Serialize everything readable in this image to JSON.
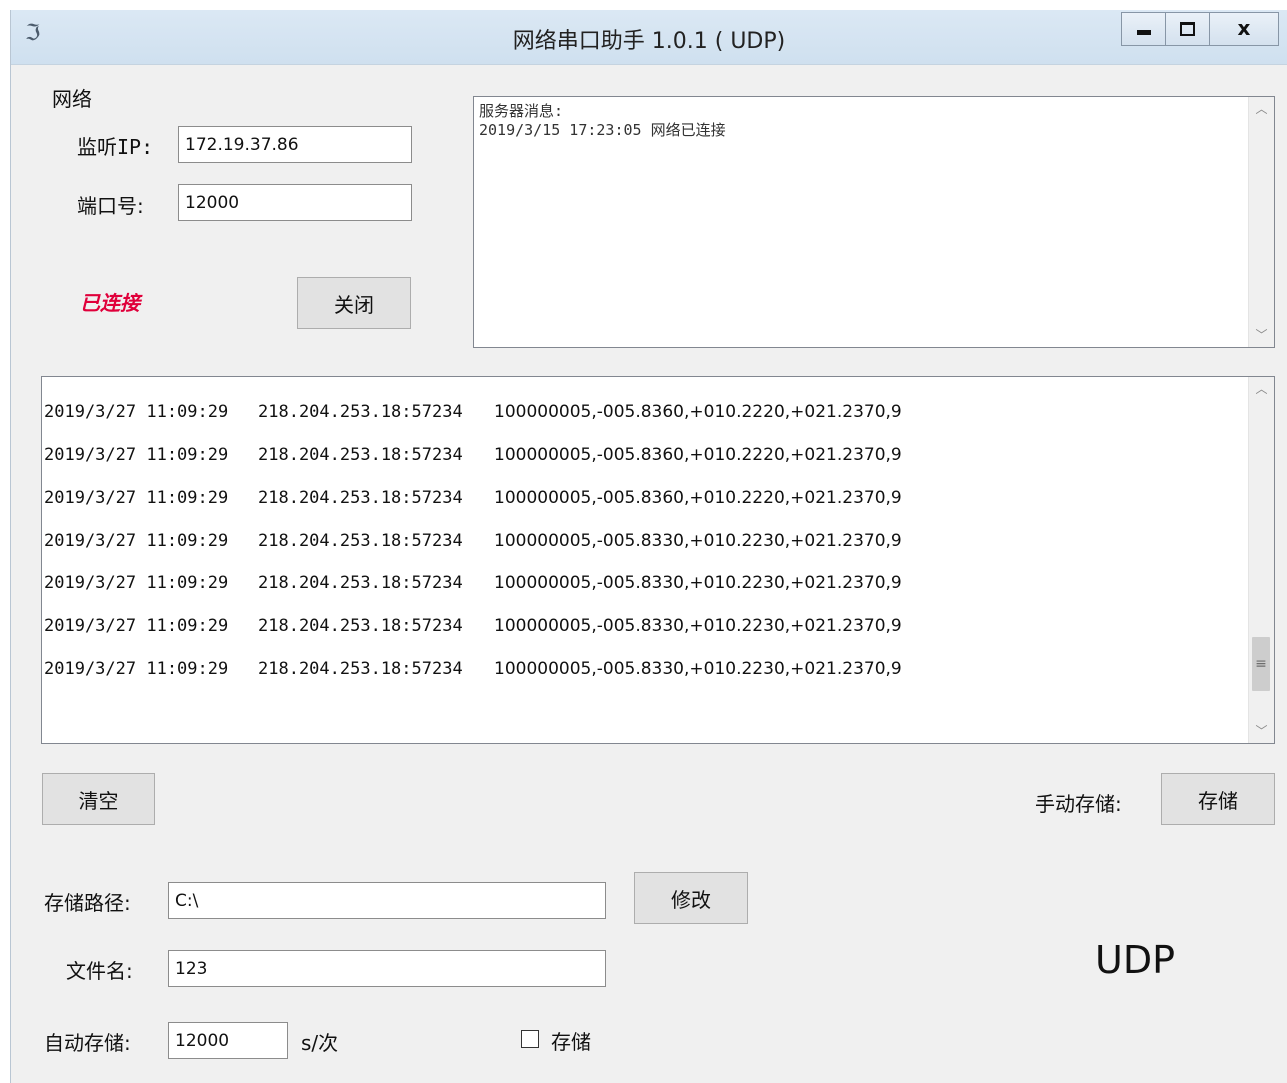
{
  "window": {
    "title": "网络串口助手 1.0.1 ( UDP)",
    "icon": "app-icon",
    "controls": {
      "minimize": "minimize",
      "maximize": "maximize",
      "close": "x"
    }
  },
  "network": {
    "group_label": "网络",
    "listen_ip_label": "监听IP:",
    "listen_ip_value": "172.19.37.86",
    "port_label": "端口号:",
    "port_value": "12000",
    "status_text": "已连接",
    "close_button": "关闭"
  },
  "server_messages": {
    "lines": [
      "服务器消息:",
      "2019/3/15 17:23:05 网络已连接"
    ]
  },
  "log": {
    "rows": [
      {
        "time": "2019/3/27 11:09:29",
        "addr": "218.204.253.18:57234",
        "data": "100000005,-005.8360,+010.2220,+021.2370,9"
      },
      {
        "time": "2019/3/27 11:09:29",
        "addr": "218.204.253.18:57234",
        "data": "100000005,-005.8360,+010.2220,+021.2370,9"
      },
      {
        "time": "2019/3/27 11:09:29",
        "addr": "218.204.253.18:57234",
        "data": "100000005,-005.8360,+010.2220,+021.2370,9"
      },
      {
        "time": "2019/3/27 11:09:29",
        "addr": "218.204.253.18:57234",
        "data": "100000005,-005.8330,+010.2230,+021.2370,9"
      },
      {
        "time": "2019/3/27 11:09:29",
        "addr": "218.204.253.18:57234",
        "data": "100000005,-005.8330,+010.2230,+021.2370,9"
      },
      {
        "time": "2019/3/27 11:09:29",
        "addr": "218.204.253.18:57234",
        "data": "100000005,-005.8330,+010.2230,+021.2370,9"
      },
      {
        "time": "2019/3/27 11:09:29",
        "addr": "218.204.253.18:57234",
        "data": "100000005,-005.8330,+010.2230,+021.2370,9"
      }
    ]
  },
  "controls": {
    "clear_button": "清空",
    "manual_save_label": "手动存储:",
    "save_button": "存储"
  },
  "storage": {
    "path_label": "存储路径:",
    "path_value": "C:\\",
    "modify_button": "修改",
    "filename_label": "文件名:",
    "filename_value": "123",
    "auto_save_label": "自动存储:",
    "auto_save_interval": "12000",
    "interval_unit": "s/次",
    "auto_save_checkbox_label": "存储",
    "auto_save_checked": false
  },
  "mode_label": "UDP"
}
